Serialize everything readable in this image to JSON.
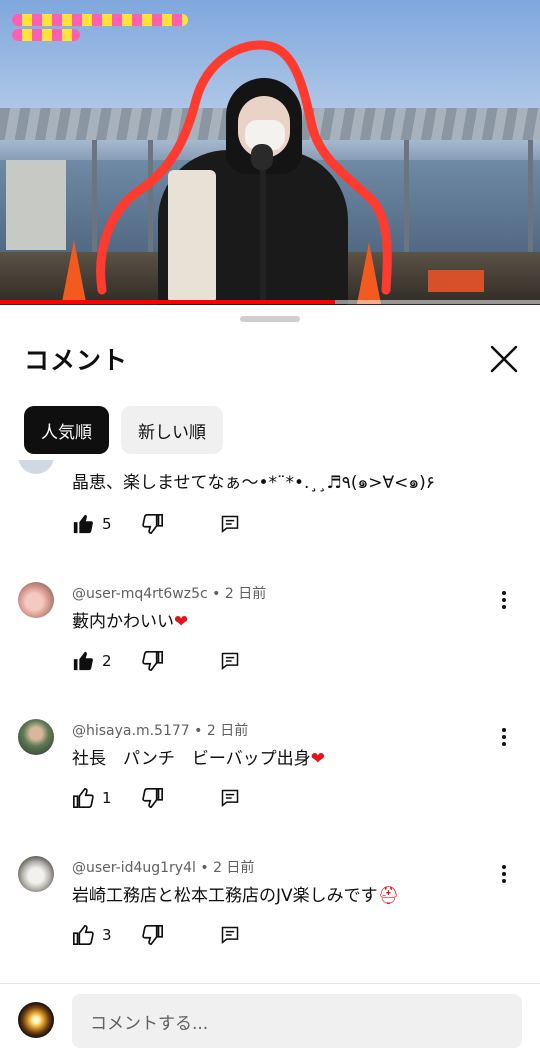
{
  "video": {
    "progress_fraction": 0.62,
    "accent_color": "#ff0000"
  },
  "sheet": {
    "title": "コメント",
    "close_icon": "close-icon",
    "sort_chips": [
      {
        "label": "人気順",
        "selected": true
      },
      {
        "label": "新しい順",
        "selected": false
      }
    ]
  },
  "comments": [
    {
      "author": "",
      "time": "",
      "text": "晶恵、楽しませてなぁ〜•*¨*•.¸¸♬٩(๑>∀<๑)۶",
      "likes": "5",
      "liked": true
    },
    {
      "author": "@user-mq4rt6wz5c",
      "time": "2 日前",
      "text": "藪内かわいい",
      "emoji": "❤",
      "likes": "2",
      "liked": true
    },
    {
      "author": "@hisaya.m.5177",
      "time": "2 日前",
      "text": "社長　パンチ　ビーバップ出身",
      "emoji": "❤",
      "likes": "1",
      "liked": false
    },
    {
      "author": "@user-id4ug1ry4l",
      "time": "2 日前",
      "text": "岩崎工務店と松本工務店のJV楽しみです",
      "emoji": "⛑",
      "likes": "3",
      "liked": false
    }
  ],
  "composer": {
    "placeholder": "コメントする..."
  },
  "meta_separator": "•"
}
